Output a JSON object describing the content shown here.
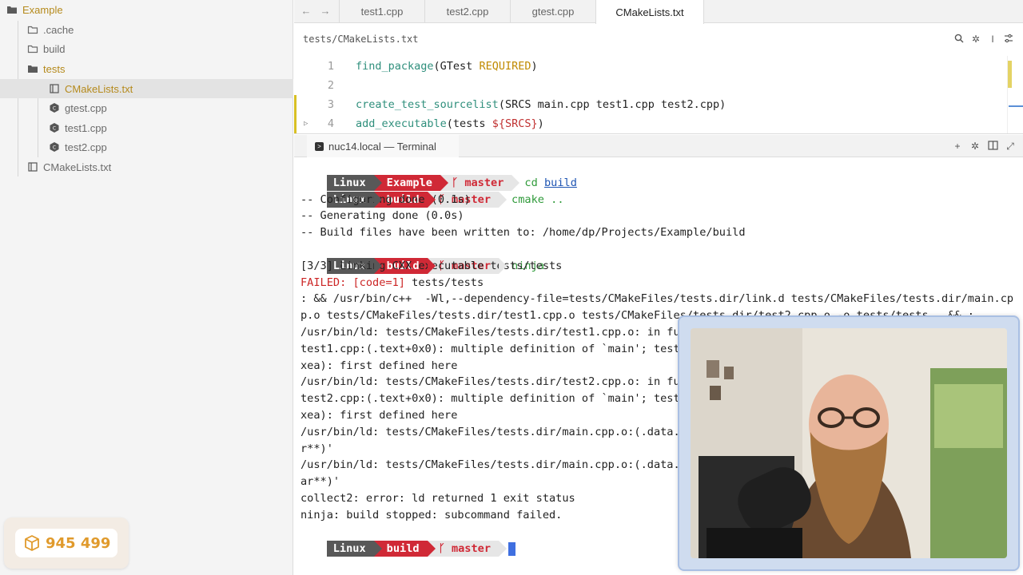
{
  "sidebar": {
    "items": [
      {
        "label": "Example",
        "type": "folder-open",
        "depth": 0,
        "accent": true
      },
      {
        "label": ".cache",
        "type": "folder",
        "depth": 1
      },
      {
        "label": "build",
        "type": "folder",
        "depth": 1
      },
      {
        "label": "tests",
        "type": "folder-open",
        "depth": 1,
        "accent": true
      },
      {
        "label": "CMakeLists.txt",
        "type": "cmake-file",
        "depth": 2,
        "accent": true,
        "selected": true
      },
      {
        "label": "gtest.cpp",
        "type": "cpp-file",
        "depth": 2
      },
      {
        "label": "test1.cpp",
        "type": "cpp-file",
        "depth": 2
      },
      {
        "label": "test2.cpp",
        "type": "cpp-file",
        "depth": 2
      },
      {
        "label": "CMakeLists.txt",
        "type": "cmake-file",
        "depth": 1
      }
    ]
  },
  "editor": {
    "tabs": [
      {
        "label": "test1.cpp",
        "active": false
      },
      {
        "label": "test2.cpp",
        "active": false
      },
      {
        "label": "gtest.cpp",
        "active": false
      },
      {
        "label": "CMakeLists.txt",
        "active": true
      }
    ],
    "breadcrumb": "tests/CMakeLists.txt",
    "lines": [
      {
        "num": "1",
        "f": "find_package",
        "a": "(GTest ",
        "k": "REQUIRED",
        "b": ")"
      },
      {
        "num": "2"
      },
      {
        "num": "3",
        "f": "create_test_sourcelist",
        "a": "(SRCS main.cpp test1.cpp test2.cpp)"
      },
      {
        "num": "4",
        "f": "add_executable",
        "a": "(tests ",
        "v": "${SRCS}",
        "b": ")"
      }
    ]
  },
  "terminal": {
    "tab_title": "nuc14.local — Terminal",
    "prompt": {
      "os": "Linux",
      "branch_icon": "ᚴ",
      "branch": "master"
    },
    "lines": [
      {
        "type": "prompt",
        "dir": "Example",
        "cmd": "cd",
        "arg": "build",
        "arg_style": "link"
      },
      {
        "type": "prompt",
        "dir": "build",
        "cmd": "cmake",
        "arg": "..",
        "arg_style": "plain"
      },
      {
        "type": "text",
        "text": "-- Configuring done (0.1s)"
      },
      {
        "type": "text",
        "text": "-- Generating done (0.0s)"
      },
      {
        "type": "text",
        "text": "-- Build files have been written to: /home/dp/Projects/Example/build"
      },
      {
        "type": "prompt",
        "dir": "build",
        "cmd": "ninja",
        "arg": ""
      },
      {
        "type": "text",
        "text": "[3/3] Linking CXX executable tests/tests"
      },
      {
        "type": "failed",
        "prefix": "FAILED: [code=1]",
        "text": " tests/tests"
      },
      {
        "type": "text",
        "text": ": && /usr/bin/c++  -Wl,--dependency-file=tests/CMakeFiles/tests.dir/link.d tests/CMakeFiles/tests.dir/main.cp"
      },
      {
        "type": "text",
        "text": "p.o tests/CMakeFiles/tests.dir/test1.cpp.o tests/CMakeFiles/tests.dir/test2.cpp.o -o tests/tests   && :"
      },
      {
        "type": "text",
        "text": "/usr/bin/ld: tests/CMakeFiles/tests.dir/test1.cpp.o: in fun"
      },
      {
        "type": "text",
        "text": "test1.cpp:(.text+0x0): multiple definition of `main'; tests"
      },
      {
        "type": "text",
        "text": "xea): first defined here"
      },
      {
        "type": "text",
        "text": "/usr/bin/ld: tests/CMakeFiles/tests.dir/test2.cpp.o: in fun"
      },
      {
        "type": "text",
        "text": "test2.cpp:(.text+0x0): multiple definition of `main'; tests"
      },
      {
        "type": "text",
        "text": "xea): first defined here"
      },
      {
        "type": "text",
        "text": "/usr/bin/ld: tests/CMakeFiles/tests.dir/main.cpp.o:(.data.r"
      },
      {
        "type": "text",
        "text": "r**)'"
      },
      {
        "type": "text",
        "text": "/usr/bin/ld: tests/CMakeFiles/tests.dir/main.cpp.o:(.data.r"
      },
      {
        "type": "text",
        "text": "ar**)'"
      },
      {
        "type": "text",
        "text": "collect2: error: ld returned 1 exit status"
      },
      {
        "type": "text",
        "text": "ninja: build stopped: subcommand failed."
      },
      {
        "type": "prompt",
        "dir": "build",
        "cmd": "",
        "arg": "",
        "cursor": true
      }
    ]
  },
  "badge": {
    "count": "945 499"
  },
  "colors": {
    "accent": "#b58a1c",
    "prompt_red": "#d02936",
    "cursor": "#3f6fe0",
    "error": "#cc2626",
    "command": "#2f9a3a"
  }
}
